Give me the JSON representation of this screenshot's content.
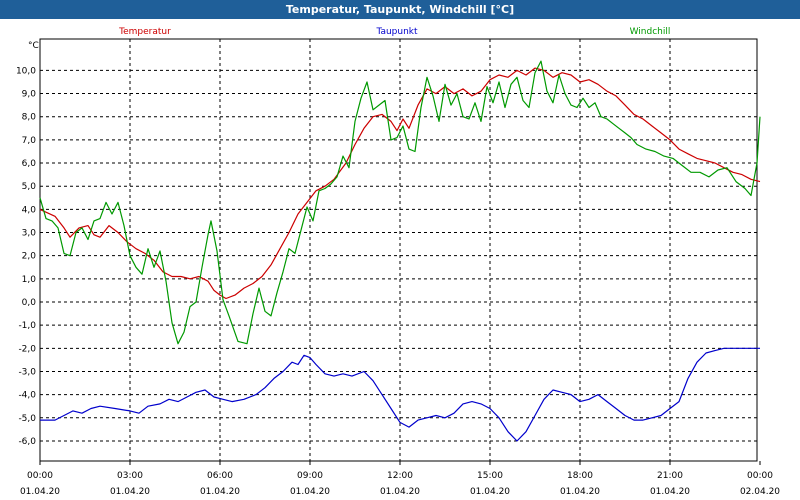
{
  "window": {
    "title": "Temperatur, Taupunkt, Windchill [°C]"
  },
  "chart_data": {
    "type": "line",
    "title": "Temperatur, Taupunkt, Windchill [°C]",
    "ylabel": "°C",
    "xlabel": "",
    "xlim": [
      0,
      24
    ],
    "ylim": [
      -6.6,
      11.2
    ],
    "grid": true,
    "legend": "top",
    "yticks": [
      10,
      9,
      8,
      7,
      6,
      5,
      4,
      3,
      2,
      1,
      0,
      -1,
      -2,
      -3,
      -4,
      -5,
      -6
    ],
    "ytick_labels": [
      "10,0",
      "9,0",
      "8,0",
      "7,0",
      "6,0",
      "5,0",
      "4,0",
      "3,0",
      "2,0",
      "1,0",
      "0,0",
      "-1,0",
      "-2,0",
      "-3,0",
      "-4,0",
      "-5,0",
      "-6,0"
    ],
    "xticks": [
      {
        "hour": 0,
        "time": "00:00",
        "date": "01.04.20"
      },
      {
        "hour": 3,
        "time": "03:00",
        "date": "01.04.20"
      },
      {
        "hour": 6,
        "time": "06:00",
        "date": "01.04.20"
      },
      {
        "hour": 9,
        "time": "09:00",
        "date": "01.04.20"
      },
      {
        "hour": 12,
        "time": "12:00",
        "date": "01.04.20"
      },
      {
        "hour": 15,
        "time": "15:00",
        "date": "01.04.20"
      },
      {
        "hour": 18,
        "time": "18:00",
        "date": "01.04.20"
      },
      {
        "hour": 21,
        "time": "21:00",
        "date": "01.04.20"
      },
      {
        "hour": 24,
        "time": "00:00",
        "date": "02.04.20"
      }
    ],
    "series": [
      {
        "name": "Temperatur",
        "color": "#cc0000",
        "points": [
          [
            0,
            4.0
          ],
          [
            0.5,
            3.7
          ],
          [
            0.8,
            3.2
          ],
          [
            1.0,
            2.8
          ],
          [
            1.3,
            3.2
          ],
          [
            1.6,
            3.3
          ],
          [
            1.8,
            2.9
          ],
          [
            2.0,
            2.8
          ],
          [
            2.3,
            3.3
          ],
          [
            2.6,
            3.0
          ],
          [
            2.9,
            2.6
          ],
          [
            3.2,
            2.3
          ],
          [
            3.5,
            2.1
          ],
          [
            3.8,
            1.8
          ],
          [
            4.1,
            1.3
          ],
          [
            4.4,
            1.1
          ],
          [
            4.7,
            1.1
          ],
          [
            5.0,
            1.0
          ],
          [
            5.3,
            1.1
          ],
          [
            5.6,
            0.9
          ],
          [
            5.8,
            0.5
          ],
          [
            6.0,
            0.3
          ],
          [
            6.2,
            0.15
          ],
          [
            6.5,
            0.3
          ],
          [
            6.8,
            0.6
          ],
          [
            7.1,
            0.8
          ],
          [
            7.4,
            1.1
          ],
          [
            7.7,
            1.6
          ],
          [
            8.0,
            2.3
          ],
          [
            8.3,
            3.0
          ],
          [
            8.6,
            3.8
          ],
          [
            8.9,
            4.3
          ],
          [
            9.2,
            4.8
          ],
          [
            9.5,
            5.0
          ],
          [
            9.8,
            5.3
          ],
          [
            10.2,
            6.0
          ],
          [
            10.5,
            6.8
          ],
          [
            10.8,
            7.5
          ],
          [
            11.1,
            8.0
          ],
          [
            11.4,
            8.1
          ],
          [
            11.7,
            7.8
          ],
          [
            11.9,
            7.4
          ],
          [
            12.1,
            7.9
          ],
          [
            12.3,
            7.5
          ],
          [
            12.6,
            8.5
          ],
          [
            12.9,
            9.2
          ],
          [
            13.2,
            9.0
          ],
          [
            13.5,
            9.3
          ],
          [
            13.8,
            9.0
          ],
          [
            14.1,
            9.2
          ],
          [
            14.4,
            8.9
          ],
          [
            14.7,
            9.1
          ],
          [
            15.0,
            9.6
          ],
          [
            15.3,
            9.8
          ],
          [
            15.6,
            9.7
          ],
          [
            15.9,
            10.0
          ],
          [
            16.2,
            9.8
          ],
          [
            16.5,
            10.1
          ],
          [
            16.8,
            10.0
          ],
          [
            17.1,
            9.7
          ],
          [
            17.4,
            9.9
          ],
          [
            17.7,
            9.8
          ],
          [
            18.0,
            9.5
          ],
          [
            18.3,
            9.6
          ],
          [
            18.6,
            9.4
          ],
          [
            18.9,
            9.1
          ],
          [
            19.2,
            8.9
          ],
          [
            19.5,
            8.5
          ],
          [
            19.8,
            8.1
          ],
          [
            20.1,
            7.9
          ],
          [
            20.4,
            7.6
          ],
          [
            20.7,
            7.3
          ],
          [
            21.0,
            7.0
          ],
          [
            21.3,
            6.6
          ],
          [
            21.6,
            6.4
          ],
          [
            21.9,
            6.2
          ],
          [
            22.2,
            6.1
          ],
          [
            22.5,
            6.0
          ],
          [
            22.8,
            5.8
          ],
          [
            23.1,
            5.6
          ],
          [
            23.4,
            5.5
          ],
          [
            23.7,
            5.3
          ],
          [
            24.0,
            5.2
          ]
        ]
      },
      {
        "name": "Taupunkt",
        "color": "#0000cc",
        "points": [
          [
            0,
            -5.1
          ],
          [
            0.5,
            -5.1
          ],
          [
            0.8,
            -4.9
          ],
          [
            1.1,
            -4.7
          ],
          [
            1.4,
            -4.8
          ],
          [
            1.7,
            -4.6
          ],
          [
            2.0,
            -4.5
          ],
          [
            2.5,
            -4.6
          ],
          [
            3.0,
            -4.7
          ],
          [
            3.3,
            -4.8
          ],
          [
            3.6,
            -4.5
          ],
          [
            4.0,
            -4.4
          ],
          [
            4.3,
            -4.2
          ],
          [
            4.6,
            -4.3
          ],
          [
            4.9,
            -4.1
          ],
          [
            5.2,
            -3.9
          ],
          [
            5.5,
            -3.8
          ],
          [
            5.8,
            -4.1
          ],
          [
            6.1,
            -4.2
          ],
          [
            6.4,
            -4.3
          ],
          [
            6.8,
            -4.2
          ],
          [
            7.2,
            -4.0
          ],
          [
            7.5,
            -3.7
          ],
          [
            7.8,
            -3.3
          ],
          [
            8.1,
            -3.0
          ],
          [
            8.4,
            -2.6
          ],
          [
            8.6,
            -2.7
          ],
          [
            8.8,
            -2.3
          ],
          [
            9.0,
            -2.4
          ],
          [
            9.2,
            -2.7
          ],
          [
            9.5,
            -3.1
          ],
          [
            9.8,
            -3.2
          ],
          [
            10.1,
            -3.1
          ],
          [
            10.4,
            -3.2
          ],
          [
            10.8,
            -3.0
          ],
          [
            11.1,
            -3.4
          ],
          [
            11.4,
            -4.0
          ],
          [
            11.7,
            -4.6
          ],
          [
            12.0,
            -5.2
          ],
          [
            12.3,
            -5.4
          ],
          [
            12.6,
            -5.1
          ],
          [
            12.9,
            -5.0
          ],
          [
            13.2,
            -4.9
          ],
          [
            13.5,
            -5.0
          ],
          [
            13.8,
            -4.8
          ],
          [
            14.1,
            -4.4
          ],
          [
            14.4,
            -4.3
          ],
          [
            14.7,
            -4.4
          ],
          [
            15.0,
            -4.6
          ],
          [
            15.3,
            -5.0
          ],
          [
            15.6,
            -5.6
          ],
          [
            15.9,
            -6.0
          ],
          [
            16.2,
            -5.6
          ],
          [
            16.5,
            -4.9
          ],
          [
            16.8,
            -4.2
          ],
          [
            17.1,
            -3.8
          ],
          [
            17.4,
            -3.9
          ],
          [
            17.7,
            -4.0
          ],
          [
            18.0,
            -4.3
          ],
          [
            18.3,
            -4.2
          ],
          [
            18.6,
            -4.0
          ],
          [
            18.9,
            -4.3
          ],
          [
            19.2,
            -4.6
          ],
          [
            19.5,
            -4.9
          ],
          [
            19.8,
            -5.1
          ],
          [
            20.1,
            -5.1
          ],
          [
            20.4,
            -5.0
          ],
          [
            20.7,
            -4.9
          ],
          [
            21.0,
            -4.6
          ],
          [
            21.3,
            -4.3
          ],
          [
            21.6,
            -3.3
          ],
          [
            21.9,
            -2.6
          ],
          [
            22.2,
            -2.2
          ],
          [
            22.5,
            -2.1
          ],
          [
            22.8,
            -2.0
          ],
          [
            23.4,
            -2.0
          ],
          [
            24.0,
            -2.0
          ]
        ]
      },
      {
        "name": "Windchill",
        "color": "#009900",
        "points": [
          [
            0,
            4.5
          ],
          [
            0.2,
            3.6
          ],
          [
            0.4,
            3.5
          ],
          [
            0.6,
            3.2
          ],
          [
            0.8,
            2.1
          ],
          [
            1.0,
            2.0
          ],
          [
            1.2,
            3.0
          ],
          [
            1.4,
            3.2
          ],
          [
            1.6,
            2.7
          ],
          [
            1.8,
            3.5
          ],
          [
            2.0,
            3.6
          ],
          [
            2.2,
            4.3
          ],
          [
            2.4,
            3.8
          ],
          [
            2.6,
            4.3
          ],
          [
            2.8,
            3.3
          ],
          [
            3.0,
            2.0
          ],
          [
            3.2,
            1.5
          ],
          [
            3.4,
            1.2
          ],
          [
            3.6,
            2.3
          ],
          [
            3.8,
            1.5
          ],
          [
            4.0,
            2.2
          ],
          [
            4.2,
            0.9
          ],
          [
            4.4,
            -0.9
          ],
          [
            4.6,
            -1.8
          ],
          [
            4.8,
            -1.3
          ],
          [
            5.0,
            -0.2
          ],
          [
            5.2,
            0.0
          ],
          [
            5.4,
            1.5
          ],
          [
            5.6,
            2.9
          ],
          [
            5.7,
            3.5
          ],
          [
            5.9,
            2.2
          ],
          [
            6.1,
            0.1
          ],
          [
            6.3,
            -0.6
          ],
          [
            6.6,
            -1.7
          ],
          [
            6.9,
            -1.8
          ],
          [
            7.1,
            -0.5
          ],
          [
            7.3,
            0.6
          ],
          [
            7.5,
            -0.4
          ],
          [
            7.7,
            -0.6
          ],
          [
            7.9,
            0.4
          ],
          [
            8.1,
            1.3
          ],
          [
            8.3,
            2.3
          ],
          [
            8.5,
            2.1
          ],
          [
            8.7,
            3.1
          ],
          [
            8.9,
            4.1
          ],
          [
            9.1,
            3.5
          ],
          [
            9.3,
            4.8
          ],
          [
            9.5,
            4.9
          ],
          [
            9.7,
            5.1
          ],
          [
            9.9,
            5.4
          ],
          [
            10.1,
            6.3
          ],
          [
            10.3,
            5.8
          ],
          [
            10.5,
            7.8
          ],
          [
            10.7,
            8.8
          ],
          [
            10.9,
            9.5
          ],
          [
            11.1,
            8.3
          ],
          [
            11.3,
            8.5
          ],
          [
            11.5,
            8.7
          ],
          [
            11.7,
            7.0
          ],
          [
            11.9,
            7.1
          ],
          [
            12.1,
            7.6
          ],
          [
            12.3,
            6.6
          ],
          [
            12.5,
            6.5
          ],
          [
            12.7,
            8.4
          ],
          [
            12.9,
            9.7
          ],
          [
            13.1,
            8.9
          ],
          [
            13.3,
            7.8
          ],
          [
            13.5,
            9.4
          ],
          [
            13.7,
            8.5
          ],
          [
            13.9,
            9.0
          ],
          [
            14.1,
            8.0
          ],
          [
            14.3,
            7.9
          ],
          [
            14.5,
            8.6
          ],
          [
            14.7,
            7.8
          ],
          [
            14.9,
            9.3
          ],
          [
            15.1,
            8.6
          ],
          [
            15.3,
            9.5
          ],
          [
            15.5,
            8.4
          ],
          [
            15.7,
            9.4
          ],
          [
            15.9,
            9.7
          ],
          [
            16.1,
            8.7
          ],
          [
            16.3,
            8.4
          ],
          [
            16.5,
            9.9
          ],
          [
            16.7,
            10.4
          ],
          [
            16.9,
            9.1
          ],
          [
            17.1,
            8.6
          ],
          [
            17.3,
            9.8
          ],
          [
            17.5,
            9.0
          ],
          [
            17.7,
            8.5
          ],
          [
            17.9,
            8.4
          ],
          [
            18.1,
            8.8
          ],
          [
            18.3,
            8.4
          ],
          [
            18.5,
            8.6
          ],
          [
            18.7,
            8.0
          ],
          [
            18.9,
            7.9
          ],
          [
            19.1,
            7.7
          ],
          [
            19.3,
            7.5
          ],
          [
            19.5,
            7.3
          ],
          [
            19.7,
            7.1
          ],
          [
            19.9,
            6.8
          ],
          [
            20.2,
            6.6
          ],
          [
            20.5,
            6.5
          ],
          [
            20.8,
            6.3
          ],
          [
            21.1,
            6.2
          ],
          [
            21.4,
            5.9
          ],
          [
            21.7,
            5.6
          ],
          [
            22.0,
            5.6
          ],
          [
            22.3,
            5.4
          ],
          [
            22.6,
            5.7
          ],
          [
            22.9,
            5.8
          ],
          [
            23.2,
            5.2
          ],
          [
            23.5,
            4.9
          ],
          [
            23.7,
            4.6
          ],
          [
            23.9,
            6.0
          ],
          [
            24.0,
            8.0
          ]
        ]
      }
    ]
  }
}
